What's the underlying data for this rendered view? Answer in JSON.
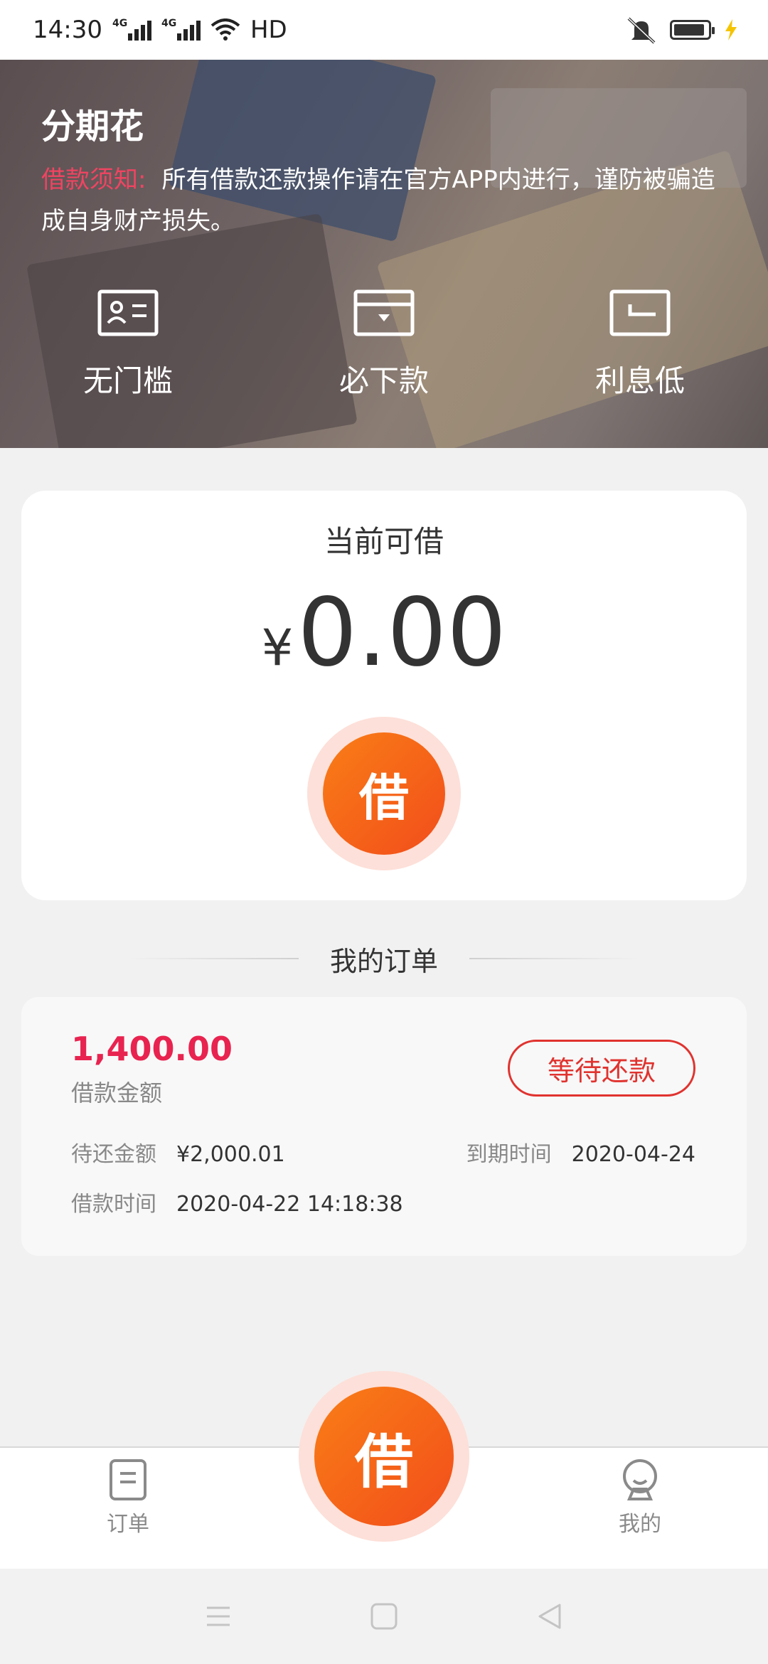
{
  "status_bar": {
    "time": "14:30",
    "network_1": "4G",
    "network_2": "4G",
    "hd_label": "HD",
    "icons": [
      "signal-icon",
      "signal-icon",
      "wifi-icon",
      "mute-icon",
      "battery-icon",
      "charging-icon"
    ]
  },
  "hero": {
    "title": "分期花",
    "notice_label": "借款须知:",
    "notice_text": "所有借款还款操作请在官方APP内进行，谨防被骗造成自身财产损失。",
    "features": [
      {
        "label": "无门槛",
        "icon": "id-card-icon"
      },
      {
        "label": "必下款",
        "icon": "wallet-icon"
      },
      {
        "label": "利息低",
        "icon": "return-card-icon"
      }
    ]
  },
  "loan": {
    "title": "当前可借",
    "currency": "¥",
    "amount": "0.00",
    "borrow_label": "借"
  },
  "orders": {
    "title": "我的订单",
    "items": [
      {
        "amount": "1,400.00",
        "amount_label": "借款金额",
        "status": "等待还款",
        "pending_label": "待还金额",
        "pending_value": "¥2,000.01",
        "due_label": "到期时间",
        "due_value": "2020-04-24",
        "loan_time_label": "借款时间",
        "loan_time_value": "2020-04-22 14:18:38"
      }
    ]
  },
  "tabbar": {
    "orders_label": "订单",
    "borrow_label": "借",
    "mine_label": "我的"
  },
  "colors": {
    "accent": "#e8234f",
    "button_orange": "#f97e16",
    "button_red": "#f24d1b",
    "status_red": "#e0332f"
  }
}
